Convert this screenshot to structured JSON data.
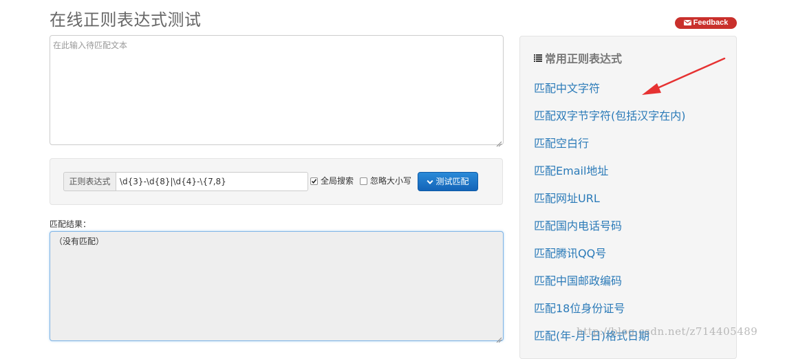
{
  "page": {
    "title": "在线正则表达式测试"
  },
  "feedback": {
    "label": "Feedback",
    "color": "#c9302c",
    "icon": "envelope-icon"
  },
  "source_text": {
    "placeholder": "在此输入待匹配文本",
    "value": ""
  },
  "regex_bar": {
    "label": "正则表达式",
    "value": "\\d{3}-\\d{8}|\\d{4}-\\{7,8}",
    "global_search": {
      "label": "全局搜索",
      "checked": true
    },
    "ignore_case": {
      "label": "忽略大小写",
      "checked": false
    },
    "test_button": {
      "label": "测试匹配",
      "icon": "chevron-down-icon",
      "color": "#1b6ec2"
    }
  },
  "result": {
    "label": "匹配结果：",
    "text": "（没有匹配）"
  },
  "sidebar": {
    "title": "常用正则表达式",
    "icon": "list-icon",
    "link_color": "#2a7ab8",
    "items": [
      "匹配中文字符",
      "匹配双字节字符(包括汉字在内)",
      "匹配空白行",
      "匹配Email地址",
      "匹配网址URL",
      "匹配国内电话号码",
      "匹配腾讯QQ号",
      "匹配中国邮政编码",
      "匹配18位身份证号",
      "匹配(年-月-日)格式日期"
    ]
  },
  "annotation": {
    "arrow_color": "#e63232"
  },
  "watermark": {
    "text": "http://blog.csdn.net/z714405489"
  }
}
